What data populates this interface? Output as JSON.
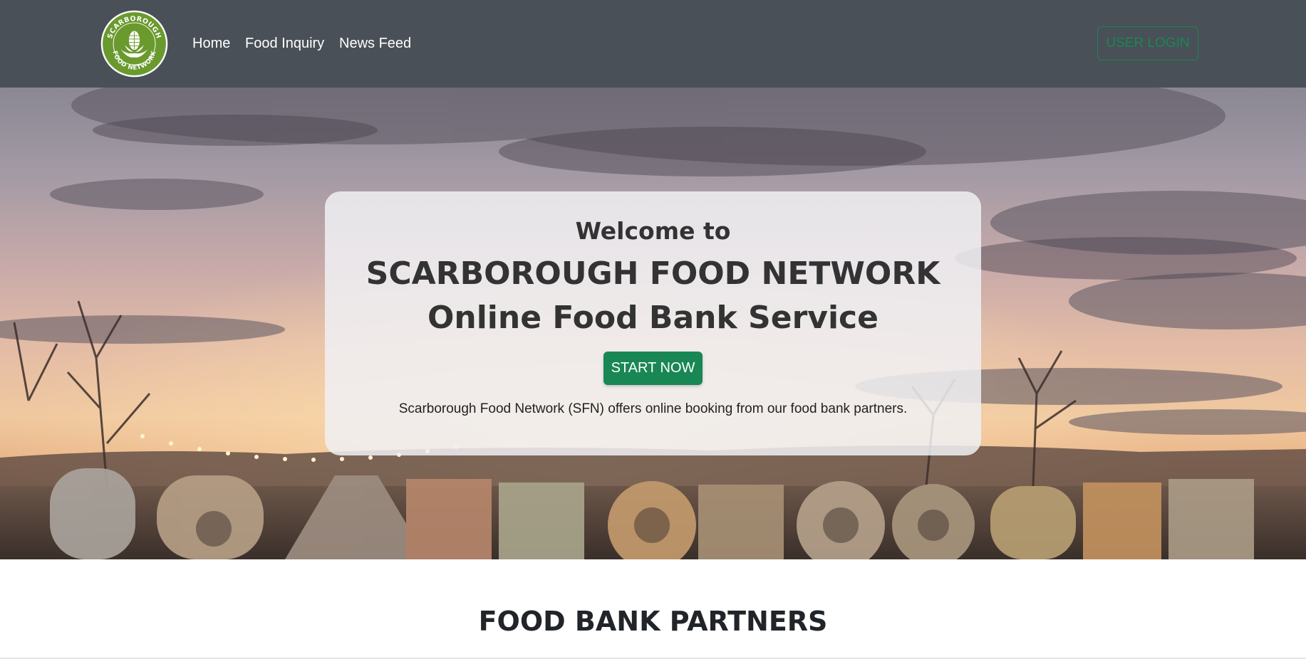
{
  "navbar": {
    "logo_text": "SCARBOROUGH FOOD NETWORK",
    "links": [
      "Home",
      "Food Inquiry",
      "News Feed"
    ],
    "login_label": "USER LOGIN"
  },
  "hero": {
    "welcome": "Welcome to",
    "title_line1": "SCARBOROUGH FOOD NETWORK",
    "title_line2": "Online Food Bank Service",
    "cta_label": "START NOW",
    "description": "Scarborough Food Network (SFN) offers online booking from our food bank partners."
  },
  "partners": {
    "heading": "FOOD BANK PARTNERS"
  },
  "colors": {
    "navbar": "#495057",
    "accent": "#198754",
    "logo_green": "#6a9a2e"
  }
}
